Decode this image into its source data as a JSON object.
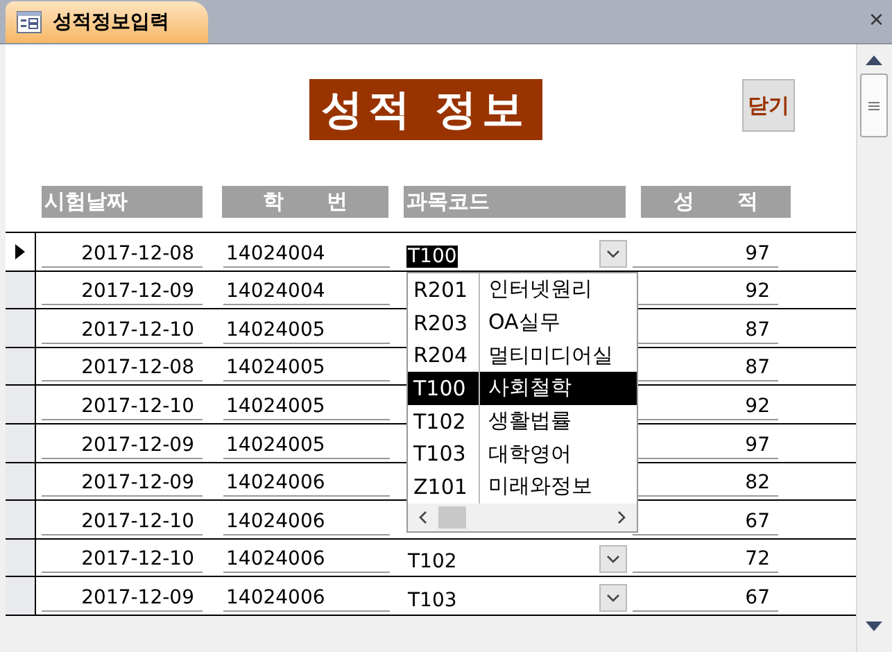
{
  "window": {
    "tab_title": "성적정보입력",
    "close": "×"
  },
  "header": {
    "title": "성적 정보",
    "close_button": "닫기"
  },
  "columns": [
    "시험날짜",
    "학      번",
    "과목코드",
    "성      적"
  ],
  "rows": [
    {
      "date": "2017-12-08",
      "student": "14024004",
      "code": "T100",
      "score": "97",
      "selected": true
    },
    {
      "date": "2017-12-09",
      "student": "14024004",
      "score": "92",
      "selected": false
    },
    {
      "date": "2017-12-10",
      "student": "14024005",
      "score": "87",
      "selected": false
    },
    {
      "date": "2017-12-08",
      "student": "14024005",
      "score": "87",
      "selected": false
    },
    {
      "date": "2017-12-10",
      "student": "14024005",
      "score": "92",
      "selected": false
    },
    {
      "date": "2017-12-09",
      "student": "14024005",
      "score": "97",
      "selected": false
    },
    {
      "date": "2017-12-09",
      "student": "14024006",
      "score": "82",
      "selected": false
    },
    {
      "date": "2017-12-10",
      "student": "14024006",
      "score": "67",
      "selected": false
    },
    {
      "date": "2017-12-10",
      "student": "14024006",
      "code": "T102",
      "score": "72",
      "selected": false
    },
    {
      "date": "2017-12-09",
      "student": "14024006",
      "code": "T103",
      "score": "67",
      "selected": false
    }
  ],
  "dropdown": {
    "items": [
      {
        "code": "R201",
        "name": "인터넷원리",
        "selected": false
      },
      {
        "code": "R203",
        "name": "OA실무",
        "selected": false
      },
      {
        "code": "R204",
        "name": "멀티미디어실",
        "selected": false
      },
      {
        "code": "T100",
        "name": "사회철학",
        "selected": true
      },
      {
        "code": "T102",
        "name": "생활법률",
        "selected": false
      },
      {
        "code": "T103",
        "name": "대학영어",
        "selected": false
      },
      {
        "code": "Z101",
        "name": "미래와정보",
        "selected": false
      }
    ]
  }
}
